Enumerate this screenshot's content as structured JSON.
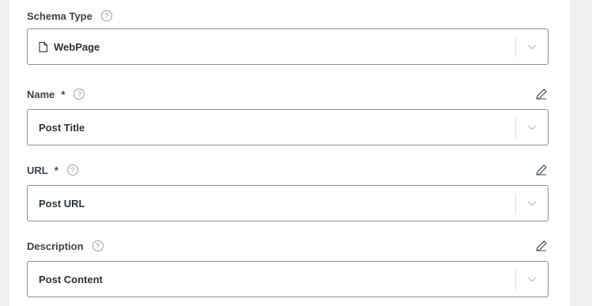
{
  "schema_type": {
    "label": "Schema Type",
    "help": "?",
    "value": "WebPage",
    "icon": "document-icon"
  },
  "fields": [
    {
      "label": "Name",
      "required": "*",
      "help": "?",
      "value": "Post Title"
    },
    {
      "label": "URL",
      "required": "*",
      "help": "?",
      "value": "Post URL"
    },
    {
      "label": "Description",
      "help": "?",
      "value": "Post Content"
    }
  ],
  "colors": {
    "border": "#8c8f94",
    "text": "#3c434a",
    "edit_icon": "#50575e"
  }
}
